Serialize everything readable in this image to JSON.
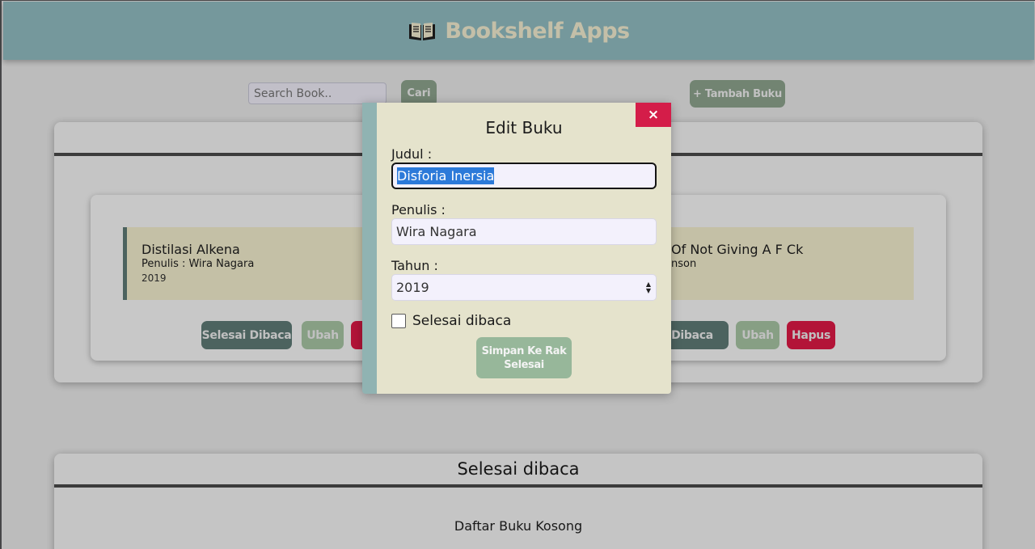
{
  "header": {
    "title": "Bookshelf Apps",
    "logo_icon": "open-book-icon"
  },
  "search": {
    "placeholder": "Search Book..",
    "button_label": "Cari"
  },
  "add_button_label": "+ Tambah Buku",
  "shelf_belum": {
    "books": [
      {
        "title": "Distilasi Alkena",
        "author": "Penulis : Wira Nagara",
        "year": "2019"
      },
      {
        "title": "Of Not Giving A F Ck",
        "author": "nson",
        "year": ""
      }
    ],
    "buttons": {
      "selesai_1": "Selesai Dibaca",
      "ubah_1": "Ubah",
      "hapus_1": "H",
      "selesai_2": "i Dibaca",
      "ubah_2": "Ubah",
      "hapus_2": "Hapus"
    }
  },
  "shelf_selesai": {
    "title": "Selesai dibaca",
    "empty_text": "Daftar Buku Kosong"
  },
  "modal": {
    "close_label": "×",
    "title": "Edit Buku",
    "judul_label": "Judul :",
    "judul_value": "Disforia Inersia",
    "penulis_label": "Penulis :",
    "penulis_value": "Wira Nagara",
    "tahun_label": "Tahun :",
    "tahun_value": "2019",
    "checkbox_label": "Selesai dibaca",
    "checkbox_checked": false,
    "submit_label": "Simpan Ke Rak Selesai"
  },
  "colors": {
    "header_bg": "#93bfc3",
    "header_title": "#f6efd2",
    "modal_bg": "#e5e3cc",
    "close_bg": "#d41d49",
    "button_green": "#8fa68f",
    "hapus_red": "#e01a47"
  }
}
